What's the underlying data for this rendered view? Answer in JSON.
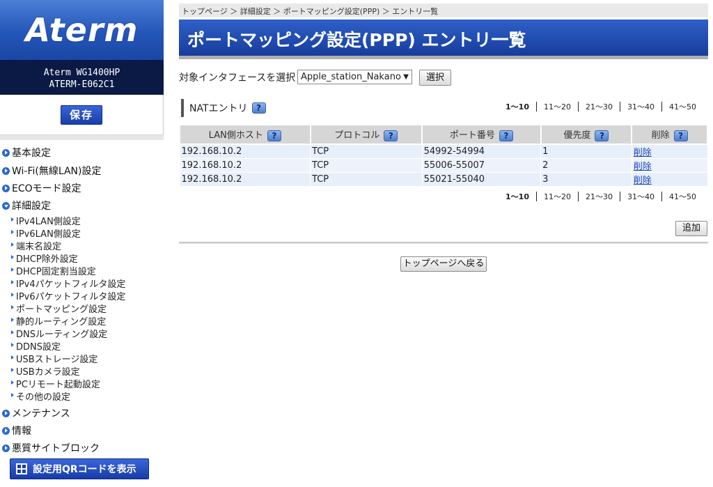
{
  "brand": {
    "logo_text": "Aterm",
    "model": "Aterm WG1400HP",
    "device_id": "ATERM-E062C1",
    "save_label": "保存"
  },
  "sidebar": {
    "top_items": [
      {
        "label": "基本設定"
      },
      {
        "label": "Wi-Fi(無線LAN)設定"
      },
      {
        "label": "ECOモード設定"
      },
      {
        "label": "詳細設定"
      },
      {
        "label": "メンテナンス"
      },
      {
        "label": "情報"
      },
      {
        "label": "悪質サイトブロック"
      }
    ],
    "sub_items": [
      "IPv4LAN側設定",
      "IPv6LAN側設定",
      "端末名設定",
      "DHCP除外設定",
      "DHCP固定割当設定",
      "IPv4パケットフィルタ設定",
      "IPv6パケットフィルタ設定",
      "ポートマッピング設定",
      "静的ルーティング設定",
      "DNSルーティング設定",
      "DDNS設定",
      "USBストレージ設定",
      "USBカメラ設定",
      "PCリモート起動設定",
      "その他の設定"
    ],
    "qr_button": "設定用QRコードを表示"
  },
  "breadcrumb": "トップページ ＞ 詳細設定 ＞ ポートマッピング設定(PPP) ＞ エントリ一覧",
  "page_title": "ポートマッピング設定(PPP) エントリ一覧",
  "interface": {
    "label": "対象インタフェースを選択",
    "selected": "Apple_station_Nakano",
    "select_button": "選択"
  },
  "nat": {
    "heading": "NATエントリ",
    "help": "?",
    "pages": [
      "1〜10",
      "11〜20",
      "21〜30",
      "31〜40",
      "41〜50"
    ],
    "columns": [
      "LAN側ホスト",
      "プロトコル",
      "ポート番号",
      "優先度",
      "削除"
    ],
    "rows": [
      {
        "host": "192.168.10.2",
        "protocol": "TCP",
        "port": "54992-54994",
        "priority": "1",
        "delete": "削除"
      },
      {
        "host": "192.168.10.2",
        "protocol": "TCP",
        "port": "55006-55007",
        "priority": "2",
        "delete": "削除"
      },
      {
        "host": "192.168.10.2",
        "protocol": "TCP",
        "port": "55021-55040",
        "priority": "3",
        "delete": "削除"
      }
    ]
  },
  "buttons": {
    "add": "追加",
    "back": "トップページへ戻る"
  }
}
